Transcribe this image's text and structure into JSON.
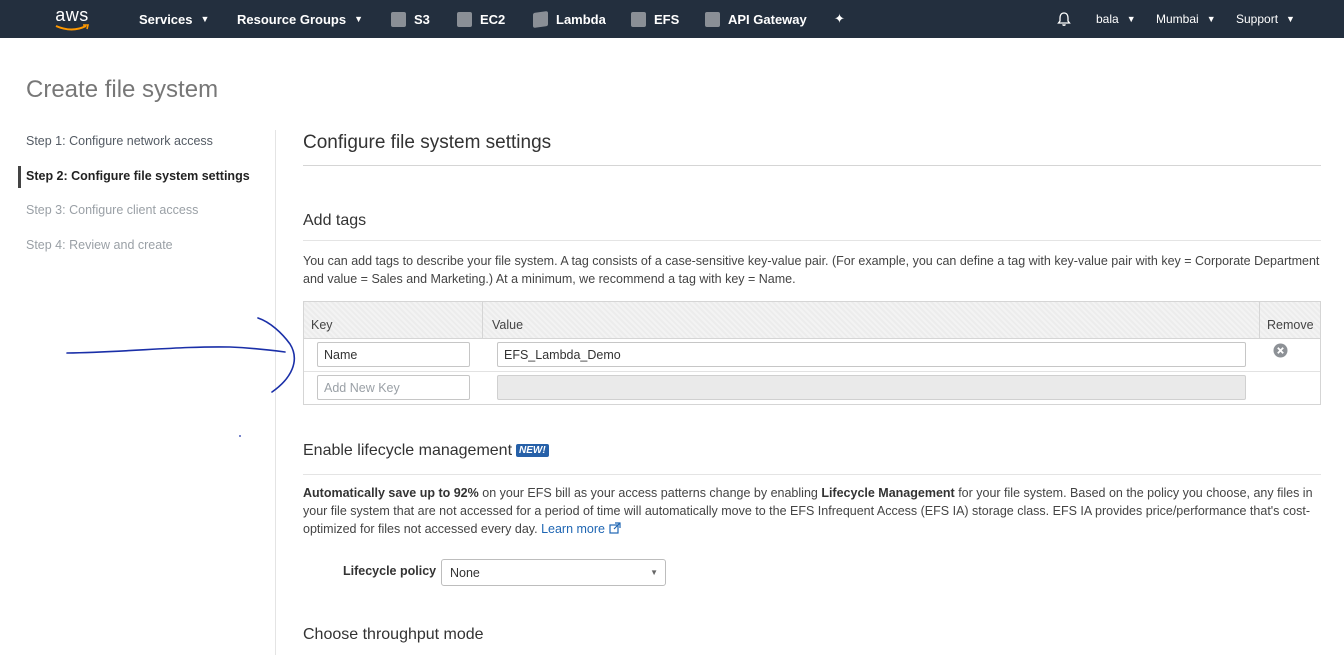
{
  "nav": {
    "logo_text": "aws",
    "services": "Services",
    "resource_groups": "Resource Groups",
    "shortcuts": [
      "S3",
      "EC2",
      "Lambda",
      "EFS",
      "API Gateway"
    ],
    "user": "bala",
    "region": "Mumbai",
    "support": "Support"
  },
  "page": {
    "title": "Create file system"
  },
  "steps": [
    {
      "label": "Step 1: Configure network access",
      "state": "done"
    },
    {
      "label": "Step 2: Configure file system settings",
      "state": "active"
    },
    {
      "label": "Step 3: Configure client access",
      "state": "disabled"
    },
    {
      "label": "Step 4: Review and create",
      "state": "disabled"
    }
  ],
  "main": {
    "heading": "Configure file system settings",
    "tags": {
      "title": "Add tags",
      "description_line1": "You can add tags to describe your file system. A tag consists of a case-sensitive key-value pair. (For example, you can define a tag with key-value pair with key = Corporate Department",
      "description_line2": "and value = Sales and Marketing.) At a minimum, we recommend a tag with key = Name.",
      "columns": {
        "key": "Key",
        "value": "Value",
        "remove": "Remove"
      },
      "rows": [
        {
          "key": "Name",
          "value": "EFS_Lambda_Demo"
        }
      ],
      "new_key_placeholder": "Add New Key"
    },
    "lifecycle": {
      "title": "Enable lifecycle management",
      "badge": "NEW!",
      "bold_intro": "Automatically save up to 92%",
      "text_a": " on your EFS bill as your access patterns change by enabling ",
      "bold_lm": "Lifecycle Management",
      "text_b": " for your file system. Based on the policy you choose, any files in",
      "line2": "your file system that are not accessed for a period of time will automatically move to the EFS Infrequent Access (EFS IA) storage class. EFS IA provides price/performance that's cost-",
      "line3": "optimized for files not accessed every day. ",
      "learn_more": "Learn more",
      "policy_label": "Lifecycle policy",
      "policy_value": "None"
    },
    "throughput": {
      "title": "Choose throughput mode"
    }
  },
  "colors": {
    "nav_bg": "#232f3e",
    "link": "#1f66b3",
    "badge": "#2660a8",
    "annotation": "#1a2fa8"
  }
}
